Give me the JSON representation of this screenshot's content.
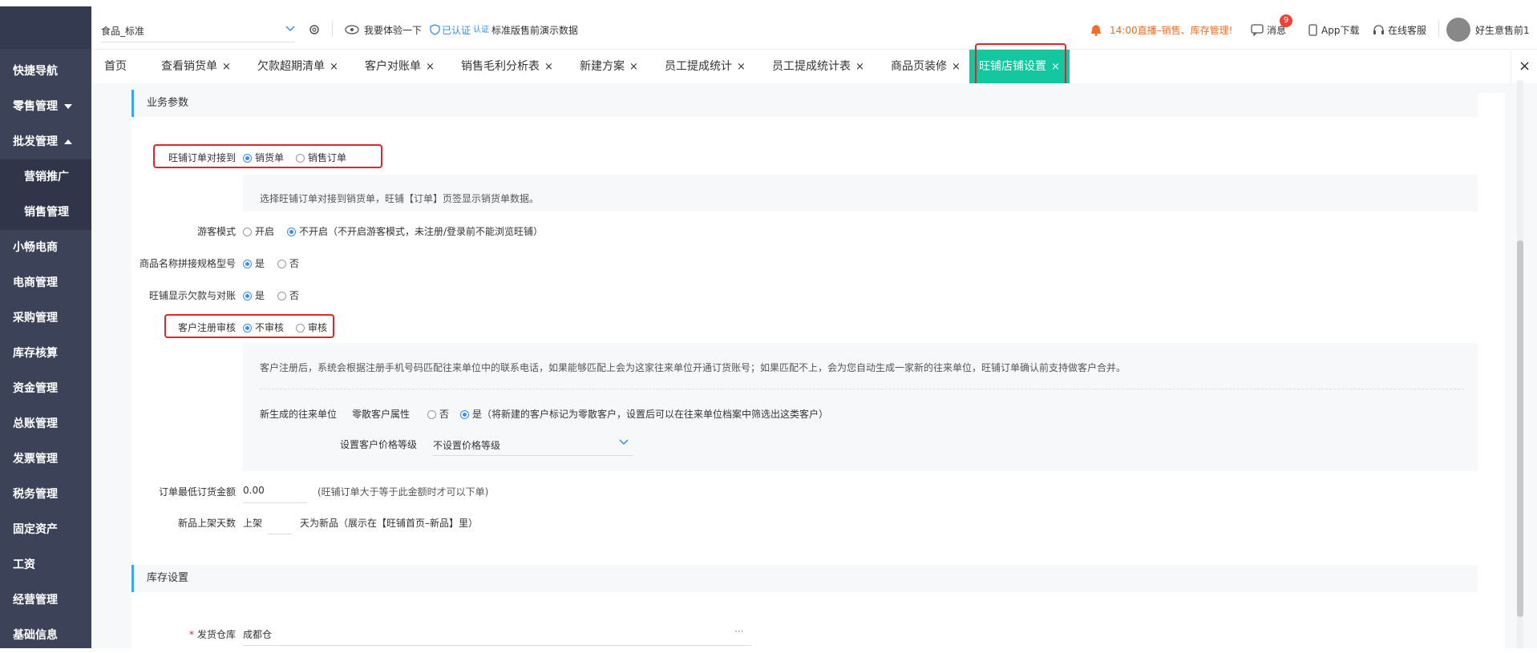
{
  "sidebar": {
    "items": [
      {
        "label": "快捷导航"
      },
      {
        "label": "零售管理"
      },
      {
        "label": "批发管理"
      },
      {
        "label": "营销推广"
      },
      {
        "label": "销售管理"
      },
      {
        "label": "小畅电商"
      },
      {
        "label": "电商管理"
      },
      {
        "label": "采购管理"
      },
      {
        "label": "库存核算"
      },
      {
        "label": "资金管理"
      },
      {
        "label": "总账管理"
      },
      {
        "label": "发票管理"
      },
      {
        "label": "税务管理"
      },
      {
        "label": "固定资产"
      },
      {
        "label": "工资"
      },
      {
        "label": "经营管理"
      },
      {
        "label": "基础信息"
      }
    ]
  },
  "header": {
    "account_select": "食品_标准",
    "try_label": "我要体验一下",
    "certified_label": "已认证",
    "certified_badge": "认证",
    "demo_label": "标准版售前演示数据",
    "live_label": "14:00直播–销售、库存管理!",
    "messages_label": "消息",
    "messages_count": "9",
    "app_label": "App下载",
    "service_label": "在线客服",
    "user_name": "好生意售前1"
  },
  "tabs": [
    {
      "label": "首页",
      "closable": false
    },
    {
      "label": "查看销货单",
      "closable": true
    },
    {
      "label": "欠款超期清单",
      "closable": true
    },
    {
      "label": "客户对账单",
      "closable": true
    },
    {
      "label": "销售毛利分析表",
      "closable": true
    },
    {
      "label": "新建方案",
      "closable": true
    },
    {
      "label": "员工提成统计",
      "closable": true
    },
    {
      "label": "员工提成统计表",
      "closable": true
    },
    {
      "label": "商品页装修",
      "closable": true
    },
    {
      "label": "旺铺店铺设置",
      "closable": true,
      "active": true
    }
  ],
  "close_all": "×",
  "close_x": "×",
  "business": {
    "title": "业务参数",
    "order_dock": {
      "label": "旺铺订单对接到",
      "options": [
        "销货单",
        "销售订单"
      ],
      "selected": 0,
      "desc": "选择旺铺订单对接到销货单，旺铺【订单】页签显示销货单数据。"
    },
    "guest_mode": {
      "label": "游客模式",
      "options": [
        "开启",
        "不开启（不开启游客模式，未注册/登录前不能浏览旺铺）"
      ],
      "selected": 1
    },
    "name_spec": {
      "label": "商品名称拼接规格型号",
      "options": [
        "是",
        "否"
      ],
      "selected": 0
    },
    "show_debt": {
      "label": "旺铺显示欠款与对账",
      "options": [
        "是",
        "否"
      ],
      "selected": 0
    },
    "register_audit": {
      "label": "客户注册审核",
      "options": [
        "不审核",
        "审核"
      ],
      "selected": 0,
      "desc": "客户注册后，系统会根据注册手机号码匹配往来单位中的联系电话，如果能够匹配上会为这家往来单位开通订货账号；如果匹配不上，会为您自动生成一家新的往来单位，旺铺订单确认前支持做客户合并。",
      "new_unit_label": "新生成的往来单位",
      "retail_label": "零散客户属性",
      "retail_options": [
        "否",
        "是（将新建的客户标记为零散客户，设置后可以在往来单位档案中筛选出这类客户）"
      ],
      "retail_selected": 1,
      "price_label": "设置客户价格等级",
      "price_value": "不设置价格等级"
    },
    "min_order": {
      "label": "订单最低订货金额",
      "value": "0.00",
      "hint": "(旺铺订单大于等于此金额时才可以下单)"
    },
    "new_days": {
      "label": "新品上架天数",
      "prefix": "上架",
      "value": "",
      "suffix": "天为新品（展示在【旺铺首页–新品】里）"
    }
  },
  "stock": {
    "title": "库存设置",
    "warehouse_label": "发货仓库",
    "required_mark": "*",
    "warehouse_value": "成都仓",
    "more": "···"
  },
  "colors": {
    "accent": "#13c7a1",
    "sidebar": "#3c4258",
    "highlight": "#e3232d",
    "radio": "#3a8ee6"
  }
}
